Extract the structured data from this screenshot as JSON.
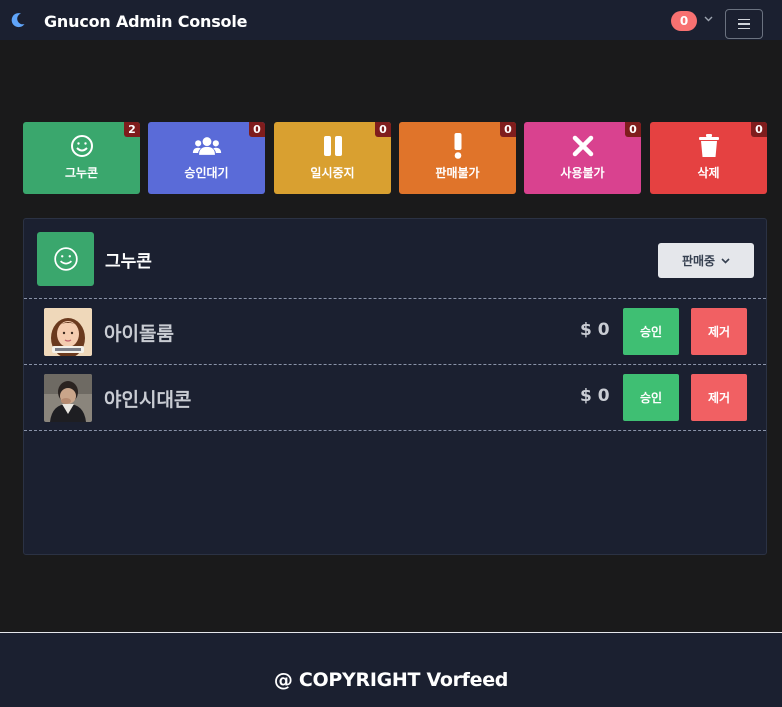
{
  "header": {
    "title": "Gnucon Admin Console",
    "notification_count": "0",
    "icons": {
      "theme": "moon-icon",
      "menu": "hamburger-icon",
      "dropdown": "chevron-down-icon"
    }
  },
  "tiles": [
    {
      "label": "그누콘",
      "count": "2",
      "icon": "smile-icon",
      "color": "#3aa76d"
    },
    {
      "label": "승인대기",
      "count": "0",
      "icon": "users-icon",
      "color": "#5a6bd8"
    },
    {
      "label": "일시중지",
      "count": "0",
      "icon": "pause-icon",
      "color": "#d9a030"
    },
    {
      "label": "판매불가",
      "count": "0",
      "icon": "exclamation-icon",
      "color": "#e0742a"
    },
    {
      "label": "사용불가",
      "count": "0",
      "icon": "x-icon",
      "color": "#d9428f"
    },
    {
      "label": "삭제",
      "count": "0",
      "icon": "trash-icon",
      "color": "#e54141"
    }
  ],
  "category": {
    "title": "그누콘",
    "status_select": "판매중"
  },
  "items": [
    {
      "name": "아이돌룸",
      "price": "$ 0",
      "approve_label": "승인",
      "remove_label": "제거"
    },
    {
      "name": "야인시대콘",
      "price": "$ 0",
      "approve_label": "승인",
      "remove_label": "제거"
    }
  ],
  "footer": {
    "copyright": "@ COPYRIGHT Vorfeed"
  }
}
